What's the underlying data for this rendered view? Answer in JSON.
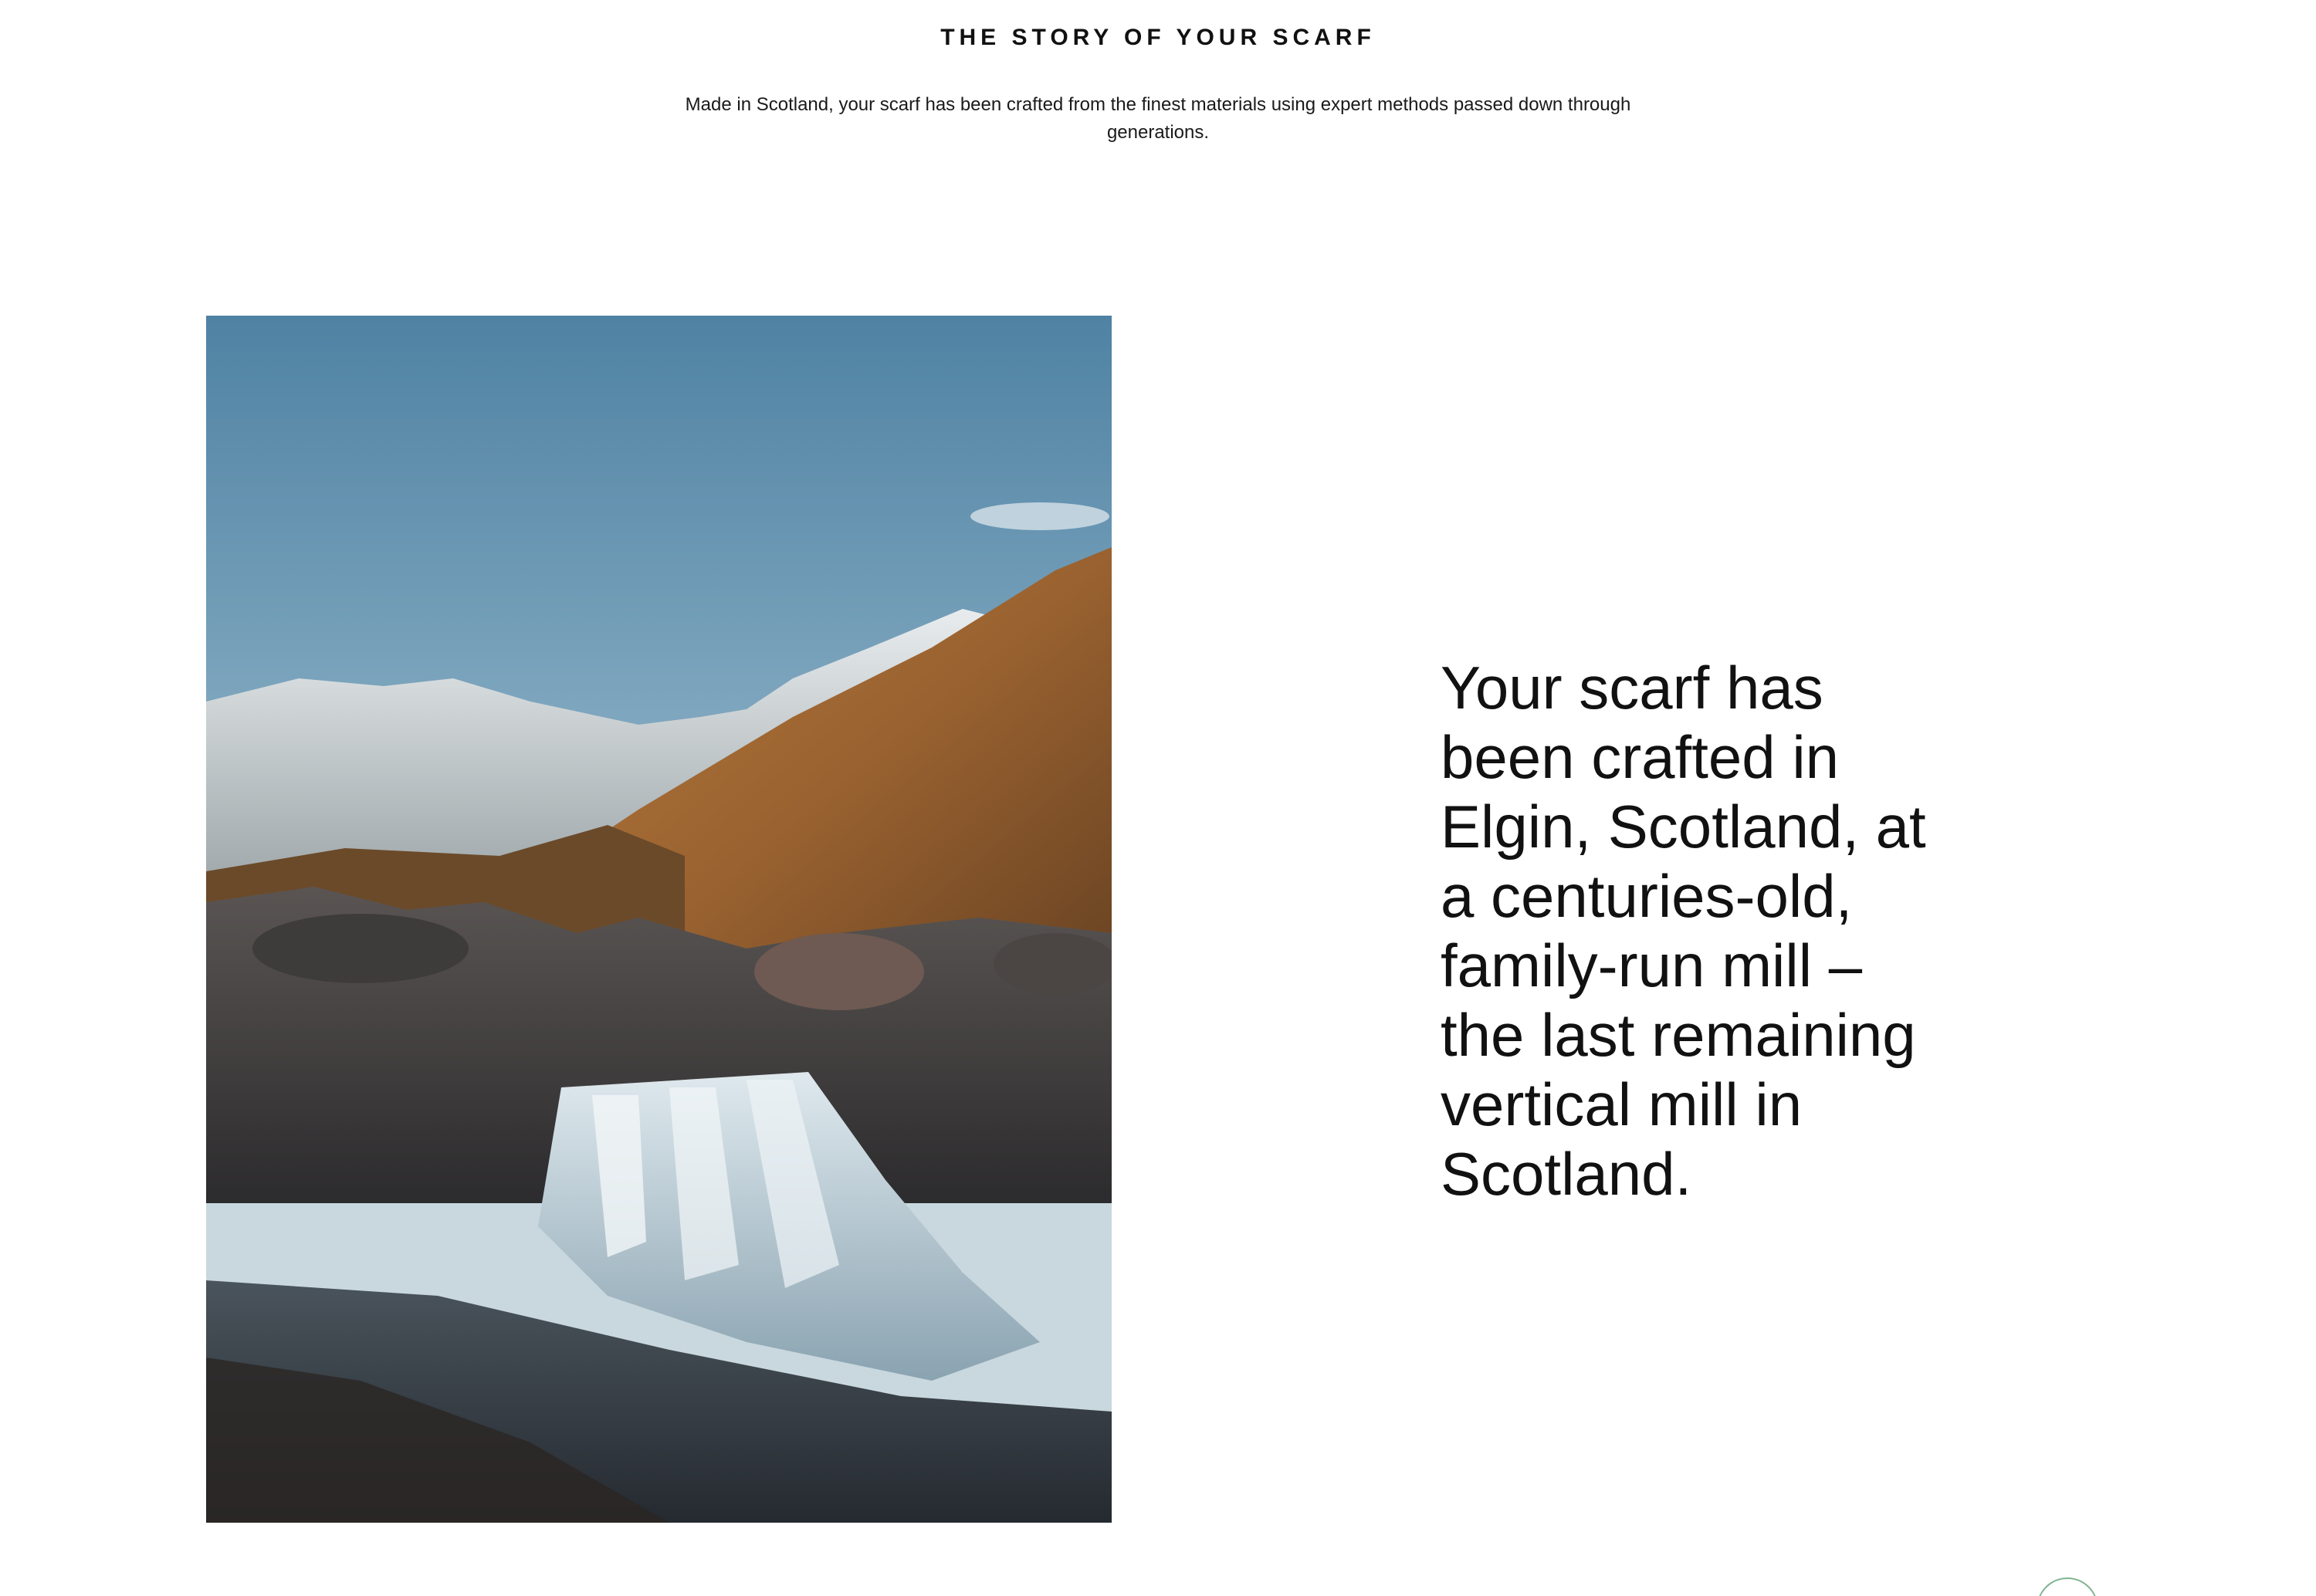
{
  "section": {
    "eyebrow": "THE STORY OF YOUR SCARF",
    "intro": "Made in Scotland, your scarf has been crafted from the finest materials using expert methods passed down through generations."
  },
  "feature": {
    "text": "Your scarf has been crafted in Elgin, Scotland, at a centuries-old, family-run mill – the last remaining vertical mill in Scotland."
  },
  "chat": {
    "icon": "chat-icon"
  },
  "colors": {
    "accent": "#7fb48f",
    "text": "#111111",
    "background": "#ffffff"
  }
}
